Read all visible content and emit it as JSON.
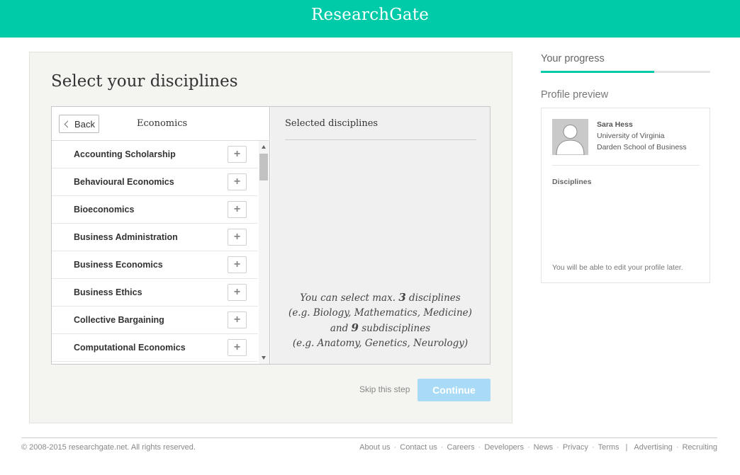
{
  "header": {
    "logo": "ResearchGate",
    "brand_color": "#00cba8"
  },
  "main": {
    "title": "Select your disciplines",
    "back_label": "Back",
    "category_title": "Economics",
    "disciplines": [
      {
        "label": "Accounting Scholarship"
      },
      {
        "label": "Behavioural Economics"
      },
      {
        "label": "Bioeconomics"
      },
      {
        "label": "Business Administration"
      },
      {
        "label": "Business Economics"
      },
      {
        "label": "Business Ethics"
      },
      {
        "label": "Collective Bargaining"
      },
      {
        "label": "Computational Economics"
      }
    ],
    "add_icon": "plus-icon",
    "selected_title": "Selected disciplines",
    "hint": {
      "line1_pre": "You can select max.",
      "max_disciplines": "3",
      "line1_post": "disciplines",
      "line2": "(e.g. Biology, Mathematics, Medicine)",
      "line3_pre": "and",
      "max_subdisciplines": "9",
      "line3_post": "subdisciplines",
      "line4": "(e.g. Anatomy, Genetics, Neurology)"
    },
    "skip_label": "Skip this step",
    "continue_label": "Continue",
    "continue_color": "#a9dbf6"
  },
  "sidebar": {
    "progress_title": "Your progress",
    "progress_fraction": 0.67,
    "preview_title": "Profile preview",
    "profile": {
      "name": "Sara Hess",
      "institution": "University of Virginia",
      "department": "Darden School of Business",
      "disciplines_label": "Disciplines",
      "edit_note": "You will be able to edit your profile later."
    }
  },
  "footer": {
    "copyright": "© 2008-2015 researchgate.net. All rights reserved.",
    "links": [
      "About us",
      "Contact us",
      "Careers",
      "Developers",
      "News",
      "Privacy",
      "Terms"
    ],
    "links_secondary": [
      "Advertising",
      "Recruiting"
    ]
  }
}
